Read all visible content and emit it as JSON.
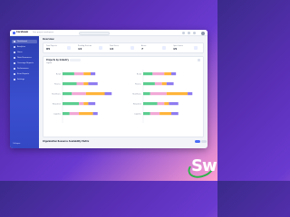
{
  "app": {
    "title": "Coreteam",
    "subtitle": "Your project workspace"
  },
  "sidebar": {
    "items": [
      {
        "label": "Dashboard",
        "active": true
      },
      {
        "label": "Analytics",
        "active": false
      },
      {
        "label": "Users",
        "active": false
      },
      {
        "label": "Data Resources",
        "active": false
      },
      {
        "label": "Coverage Reports",
        "active": false
      },
      {
        "label": "Performance",
        "active": false
      },
      {
        "label": "Error Reports",
        "active": false
      },
      {
        "label": "Settings",
        "active": false
      }
    ],
    "collapse_label": "Collapse"
  },
  "overview": {
    "title": "Overview",
    "stats": [
      {
        "label": "Total Projects",
        "value": "85"
      },
      {
        "label": "Pending Reviews",
        "value": "14"
      },
      {
        "label": "Total Users",
        "value": "14"
      },
      {
        "label": "Active",
        "value": "7"
      },
      {
        "label": "Open Issues",
        "value": "15"
      }
    ]
  },
  "chart_section": {
    "title": "Projects by Industry",
    "legend": "Legend"
  },
  "chart_data": [
    {
      "type": "bar",
      "orientation": "horizontal",
      "stacked": true,
      "categories": [
        "Retail",
        "Finance",
        "Healthcare",
        "Education",
        "Logistics"
      ],
      "series": [
        {
          "values": [
            5,
            6,
            4,
            7,
            3
          ],
          "color": "#5ccd8f"
        },
        {
          "values": [
            4,
            3,
            6,
            2,
            4
          ],
          "color": "#f2a8d6"
        },
        {
          "values": [
            3,
            2,
            8,
            2,
            6
          ],
          "color": "#ffb43a"
        },
        {
          "values": [
            2,
            4,
            3,
            3,
            2
          ],
          "color": "#8f7bf0"
        }
      ]
    },
    {
      "type": "bar",
      "orientation": "horizontal",
      "stacked": true,
      "categories": [
        "Retail",
        "Finance",
        "Healthcare",
        "Education",
        "Logistics"
      ],
      "series": [
        {
          "values": [
            4,
            5,
            3,
            6,
            3
          ],
          "color": "#5ccd8f"
        },
        {
          "values": [
            5,
            3,
            7,
            3,
            4
          ],
          "color": "#f2a8d6"
        },
        {
          "values": [
            3,
            2,
            9,
            2,
            5
          ],
          "color": "#ffb43a"
        },
        {
          "values": [
            2,
            3,
            2,
            4,
            3
          ],
          "color": "#8f7bf0"
        }
      ]
    }
  ],
  "bottom": {
    "title": "Organization Resource Availability Matrix"
  },
  "watermark": {
    "text": "Sw"
  },
  "colors": {
    "accent": "#4a6cf7",
    "sidebar": "#3448c4"
  }
}
